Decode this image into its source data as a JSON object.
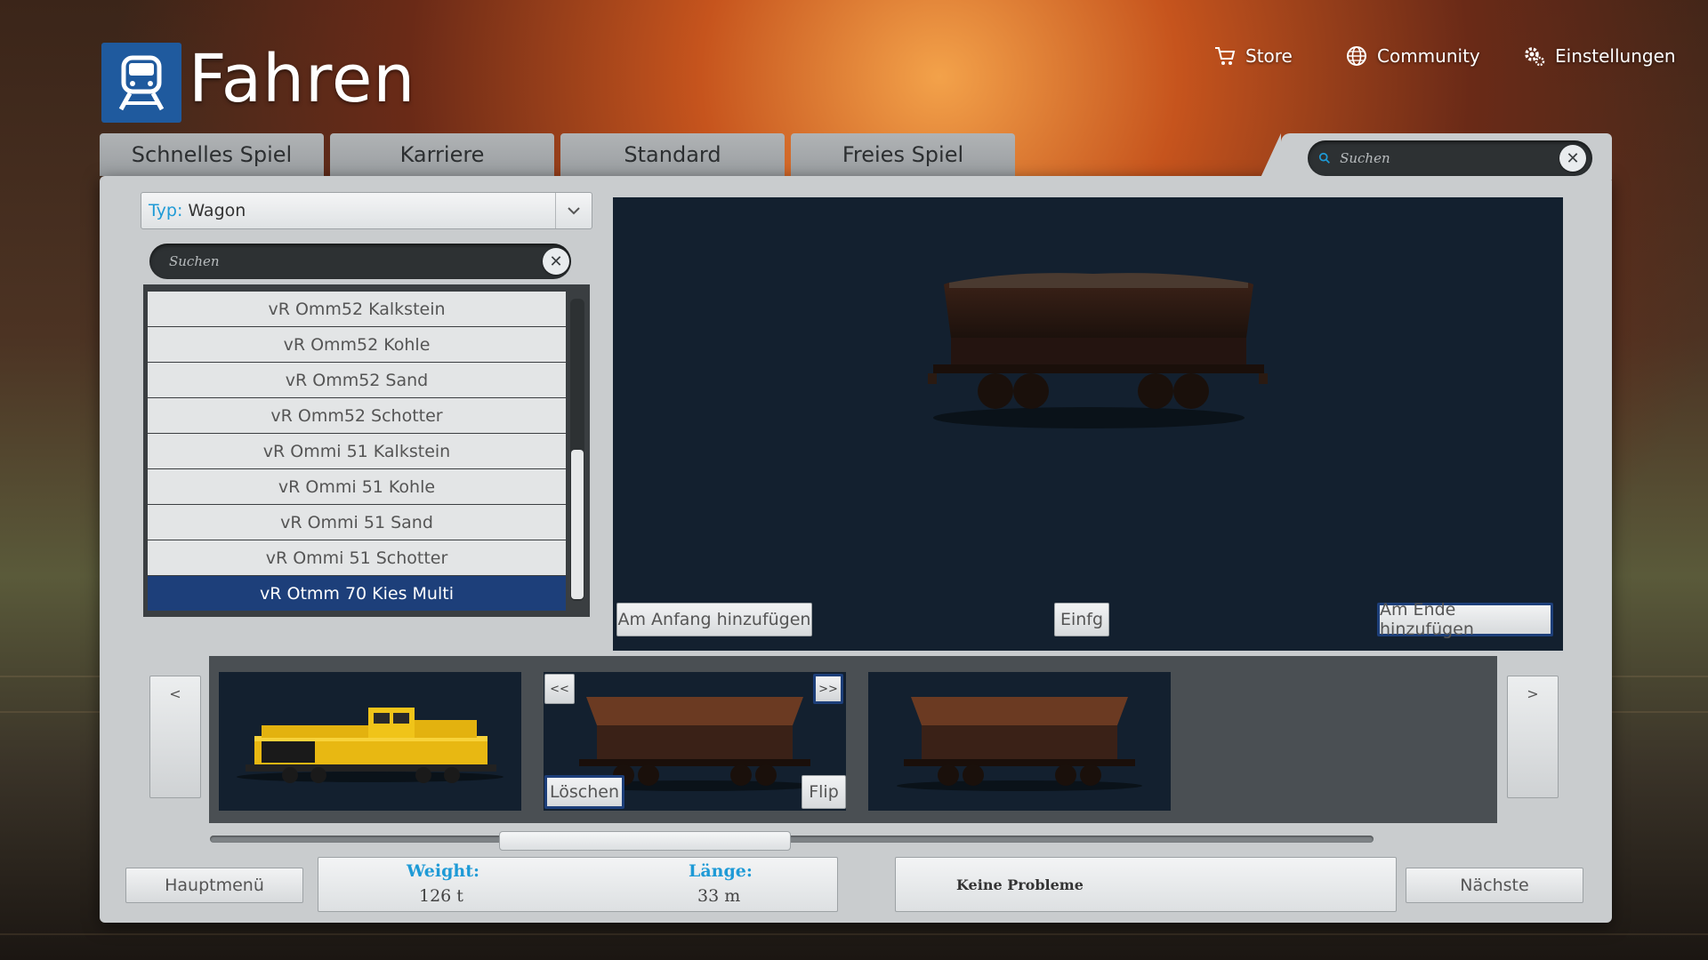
{
  "header": {
    "title": "Fahren",
    "nav": [
      {
        "label": "Store",
        "icon": "cart-icon"
      },
      {
        "label": "Community",
        "icon": "globe-icon"
      },
      {
        "label": "Einstellungen",
        "icon": "gears-icon"
      }
    ]
  },
  "tabs": [
    "Schnelles Spiel",
    "Karriere",
    "Standard",
    "Freies Spiel"
  ],
  "global_search": {
    "placeholder": "Suchen"
  },
  "type_filter": {
    "label": "Typ:",
    "value": "Wagon"
  },
  "list_search": {
    "placeholder": "Suchen"
  },
  "list": {
    "items": [
      "vR Omm52 Kalkstein",
      "vR Omm52 Kohle",
      "vR Omm52 Sand",
      "vR Omm52 Schotter",
      "vR Ommi 51 Kalkstein",
      "vR Ommi 51 Kohle",
      "vR Ommi 51 Sand",
      "vR Ommi 51 Schotter",
      "vR Otmm 70 Kies Multi"
    ],
    "selected_index": 8
  },
  "preview": {
    "add_start": "Am Anfang hinzufügen",
    "insert": "Einfg",
    "add_end": "Am Ende hinzufügen"
  },
  "consist": {
    "prev": "<",
    "next": ">",
    "move_left": "<<",
    "move_right": ">>",
    "delete": "Löschen",
    "flip": "Flip"
  },
  "footer": {
    "main_menu": "Hauptmenü",
    "weight_label": "Weight:",
    "weight_value": "126 t",
    "length_label": "Länge:",
    "length_value": "33 m",
    "status": "Keine Probleme",
    "next": "Nächste"
  },
  "colors": {
    "accent_blue": "#1e9ad6",
    "selected_navy": "#1d3f7a",
    "locomotive_yellow": "#f0c419",
    "wagon_rust": "#6b3a22"
  }
}
